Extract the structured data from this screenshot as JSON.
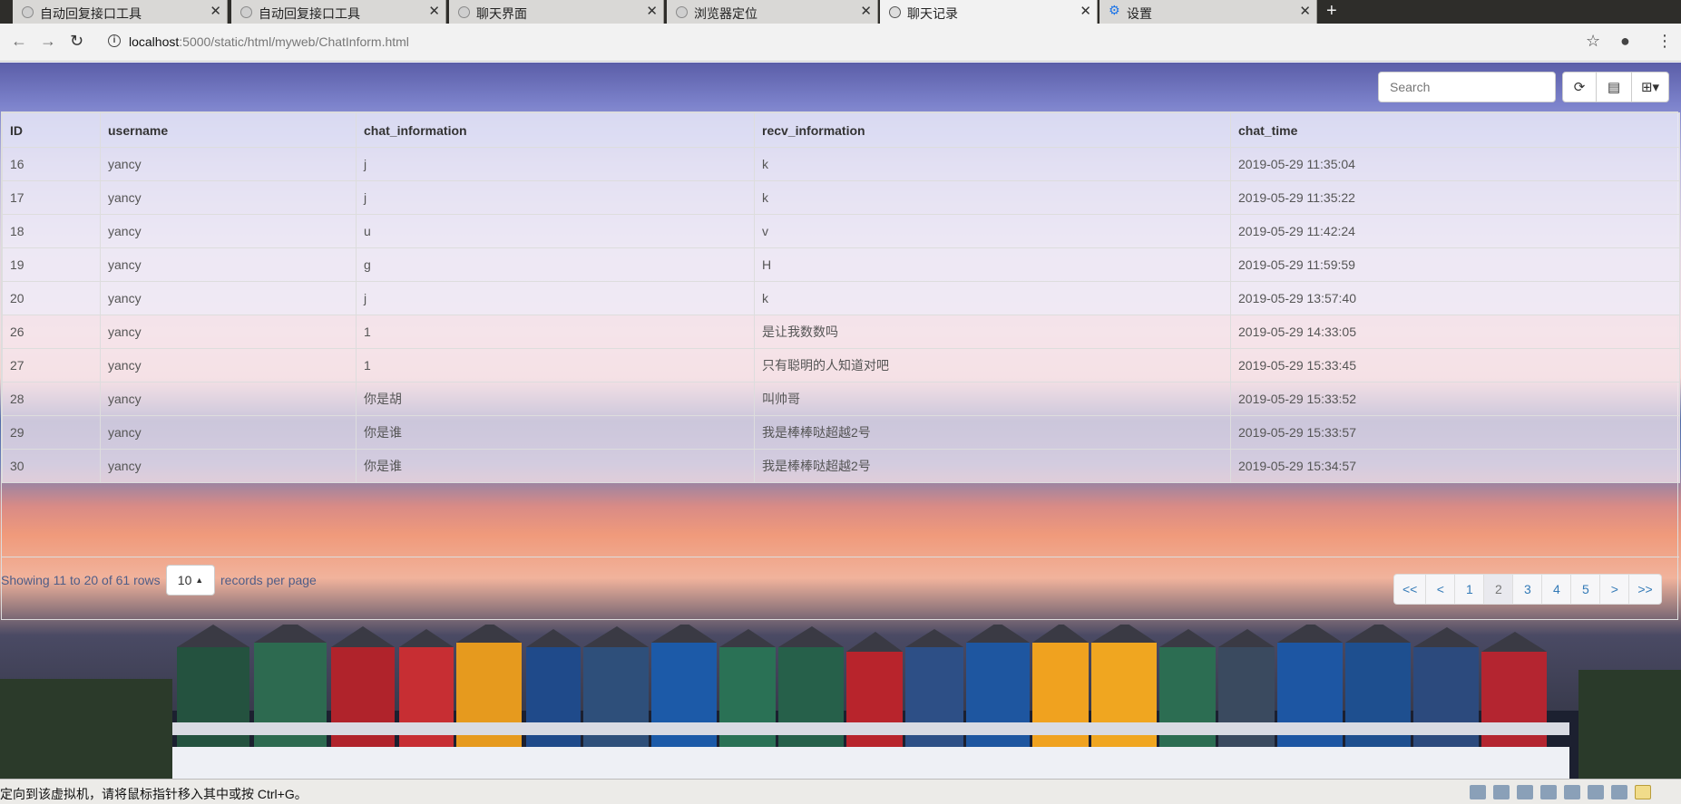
{
  "browser": {
    "tabs": [
      {
        "title": "自动回复接口工具",
        "active": false,
        "icon": "globe-icon"
      },
      {
        "title": "自动回复接口工具",
        "active": false,
        "icon": "globe-icon"
      },
      {
        "title": "聊天界面",
        "active": false,
        "icon": "globe-icon"
      },
      {
        "title": "浏览器定位",
        "active": false,
        "icon": "globe-icon"
      },
      {
        "title": "聊天记录",
        "active": true,
        "icon": "globe-icon"
      },
      {
        "title": "设置",
        "active": false,
        "icon": "gear-icon"
      }
    ],
    "url_host": "localhost",
    "url_path": ":5000/static/html/myweb/ChatInform.html"
  },
  "table_toolbar": {
    "search_placeholder": "Search"
  },
  "table": {
    "columns": [
      "ID",
      "username",
      "chat_information",
      "recv_information",
      "chat_time"
    ],
    "rows": [
      [
        "16",
        "yancy",
        "j",
        "k",
        "2019-05-29 11:35:04"
      ],
      [
        "17",
        "yancy",
        "j",
        "k",
        "2019-05-29 11:35:22"
      ],
      [
        "18",
        "yancy",
        "u",
        "v",
        "2019-05-29 11:42:24"
      ],
      [
        "19",
        "yancy",
        "g",
        "H",
        "2019-05-29 11:59:59"
      ],
      [
        "20",
        "yancy",
        "j",
        "k",
        "2019-05-29 13:57:40"
      ],
      [
        "26",
        "yancy",
        "1",
        "是让我数数吗",
        "2019-05-29 14:33:05"
      ],
      [
        "27",
        "yancy",
        "1",
        "只有聪明的人知道对吧",
        "2019-05-29 15:33:45"
      ],
      [
        "28",
        "yancy",
        "你是胡",
        "叫帅哥",
        "2019-05-29 15:33:52"
      ],
      [
        "29",
        "yancy",
        "你是谁",
        "我是棒棒哒超越2号",
        "2019-05-29 15:33:57"
      ],
      [
        "30",
        "yancy",
        "你是谁",
        "我是棒棒哒超越2号",
        "2019-05-29 15:34:57"
      ]
    ]
  },
  "pagination": {
    "info": "Showing 11 to 20 of 61 rows",
    "page_size": "10",
    "after": "records per page",
    "pages": [
      "<<",
      "<",
      "1",
      "2",
      "3",
      "4",
      "5",
      ">",
      ">>"
    ],
    "active_page": "2"
  },
  "vm_status": {
    "message": "定向到该虚拟机，请将鼠标指针移入其中或按 Ctrl+G。"
  }
}
